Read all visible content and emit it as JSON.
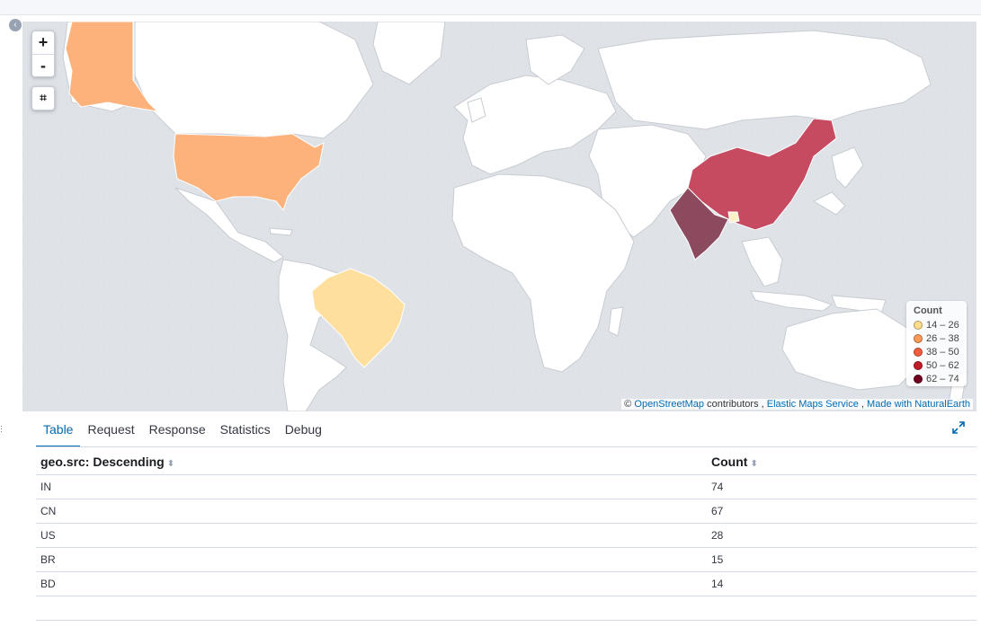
{
  "map": {
    "zoom_in_label": "+",
    "zoom_out_label": "-",
    "crop_icon": "crop-icon",
    "collapse_icon": "chevron-left-icon",
    "legend": {
      "title": "Count",
      "items": [
        {
          "label": "14 – 26",
          "color": "#fddc8c"
        },
        {
          "label": "26 – 38",
          "color": "#fb9a58"
        },
        {
          "label": "38 – 50",
          "color": "#f15d3e"
        },
        {
          "label": "50 – 62",
          "color": "#c01c2a"
        },
        {
          "label": "62 – 74",
          "color": "#70001f"
        }
      ]
    },
    "attribution": {
      "copyright": "©",
      "osm_link": "OpenStreetMap",
      "contributors": "contributors ,",
      "ems_link": "Elastic Maps Service",
      "separator": ",",
      "ne_link": "Made with NaturalEarth"
    },
    "regions": [
      {
        "name": "IN",
        "value": 74,
        "color": "#8b4a5e"
      },
      {
        "name": "CN",
        "value": 67,
        "color": "#c64b61"
      },
      {
        "name": "US",
        "value": 28,
        "color": "#fdb27c"
      },
      {
        "name": "BR",
        "value": 15,
        "color": "#fedf9e"
      },
      {
        "name": "BD",
        "value": 14,
        "color": "#fdf0c8"
      }
    ]
  },
  "tabs": [
    {
      "label": "Table",
      "active": true
    },
    {
      "label": "Request",
      "active": false
    },
    {
      "label": "Response",
      "active": false
    },
    {
      "label": "Statistics",
      "active": false
    },
    {
      "label": "Debug",
      "active": false
    }
  ],
  "table": {
    "headers": [
      "geo.src: Descending",
      "Count"
    ],
    "rows": [
      [
        "IN",
        "74"
      ],
      [
        "CN",
        "67"
      ],
      [
        "US",
        "28"
      ],
      [
        "BR",
        "15"
      ],
      [
        "BD",
        "14"
      ]
    ]
  }
}
